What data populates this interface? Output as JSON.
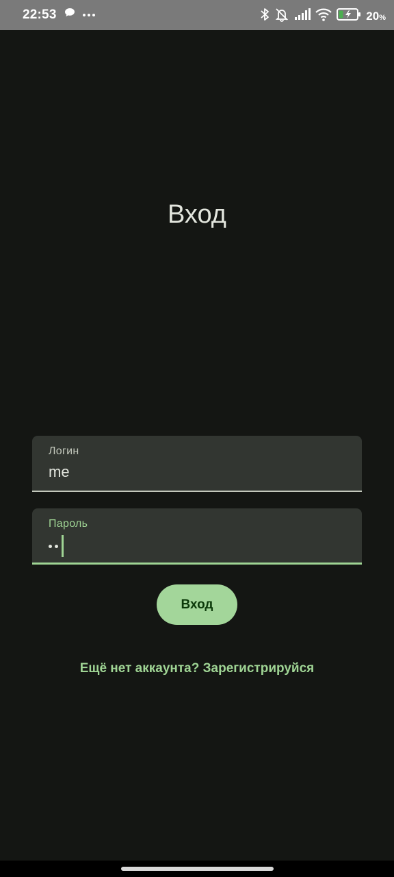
{
  "status_bar": {
    "time": "22:53",
    "battery_percent": "20",
    "battery_unit": "%",
    "battery_level": 0.2,
    "icons_left": [
      "chat-bubble-icon",
      "more-dots-icon"
    ],
    "icons_right": [
      "bluetooth-icon",
      "bell-off-icon",
      "signal-icon",
      "wifi-icon",
      "battery-charging-icon"
    ]
  },
  "screen": {
    "title": "Вход"
  },
  "login_field": {
    "label": "Логин",
    "value": "me"
  },
  "password_field": {
    "label": "Пароль",
    "masked_length": 2
  },
  "login_button": {
    "label": "Вход"
  },
  "register_link": {
    "text": "Ещё нет аккаунта? Зарегистрируйся"
  },
  "colors": {
    "background": "#141613",
    "accent": "#9fd494",
    "button_bg": "#a3d69a",
    "field_bg": "#323631"
  }
}
